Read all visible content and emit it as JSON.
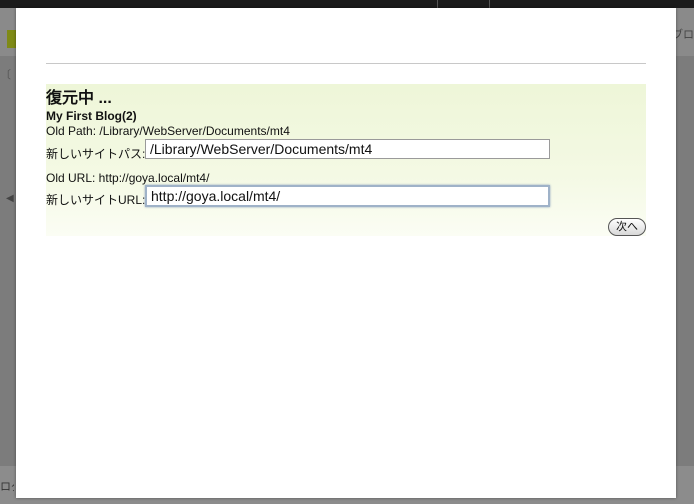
{
  "background": {
    "header_tab_text": "ブログ",
    "footer_text": "ログ",
    "left_arrow": "◀",
    "left_bracket": "〔"
  },
  "dialog": {
    "title": "復元中 ...",
    "blog_name": "My First Blog(2)",
    "old_path_text": "Old Path: /Library/WebServer/Documents/mt4",
    "new_site_path_label": "新しいサイトパス:",
    "new_site_path_value": "/Library/WebServer/Documents/mt4",
    "old_url_text": "Old URL: http://goya.local/mt4/",
    "new_site_url_label": "新しいサイトURL:",
    "new_site_url_value": "http://goya.local/mt4/",
    "next_button_label": "次へ"
  }
}
